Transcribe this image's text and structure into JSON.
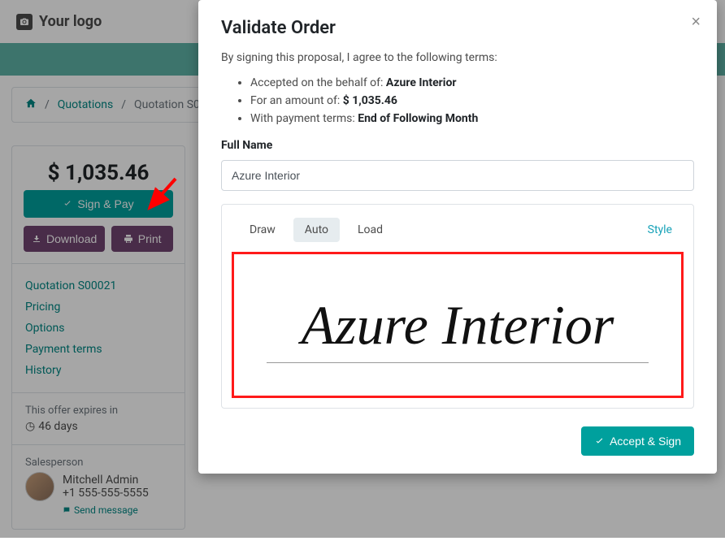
{
  "header": {
    "logo_text": "Your logo"
  },
  "breadcrumb": {
    "quotations": "Quotations",
    "current": "Quotation S0"
  },
  "sidebar": {
    "amount": "$ 1,035.46",
    "sign_pay": "Sign & Pay",
    "download": "Download",
    "print": "Print",
    "nav": {
      "quotation": "Quotation S00021",
      "pricing": "Pricing",
      "options": "Options",
      "payment_terms": "Payment terms",
      "history": "History"
    },
    "expires_label": "This offer expires in",
    "expires_value": "46 days",
    "salesperson_label": "Salesperson",
    "salesperson_name": "Mitchell Admin",
    "salesperson_phone": "+1 555-555-5555",
    "send_message": "Send message"
  },
  "modal": {
    "title": "Validate Order",
    "intro": "By signing this proposal, I agree to the following terms:",
    "term1_prefix": "Accepted on the behalf of: ",
    "term1_value": "Azure Interior",
    "term2_prefix": "For an amount of: ",
    "term2_value": "$ 1,035.46",
    "term3_prefix": "With payment terms: ",
    "term3_value": "End of Following Month",
    "fullname_label": "Full Name",
    "fullname_value": "Azure Interior",
    "tabs": {
      "draw": "Draw",
      "auto": "Auto",
      "load": "Load",
      "style": "Style"
    },
    "signature_text": "Azure Interior",
    "accept_sign": "Accept & Sign"
  }
}
